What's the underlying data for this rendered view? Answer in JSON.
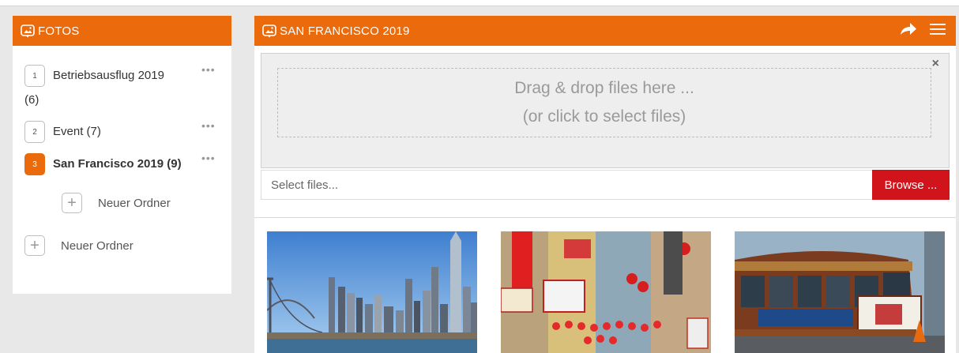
{
  "sidebar": {
    "title": "FOTOS",
    "folders": [
      {
        "index": "1",
        "name": "Betriebsausflug 2019",
        "count": "(6)",
        "active": false
      },
      {
        "index": "2",
        "name": "Event (7)",
        "active": false
      },
      {
        "index": "3",
        "name": "San Francisco 2019 (9)",
        "active": true
      }
    ],
    "more_label": "•••",
    "new_subfolder_label": "Neuer Ordner",
    "new_folder_label": "Neuer Ordner"
  },
  "main": {
    "title": "SAN FRANCISCO 2019",
    "upload": {
      "drop_line1": "Drag & drop files here ...",
      "drop_line2": "(or click to select files)",
      "close_label": "×",
      "placeholder": "Select files...",
      "browse_label": "Browse ..."
    },
    "photos": [
      {
        "subject": "skyline-bridge"
      },
      {
        "subject": "chinatown-street"
      },
      {
        "subject": "cable-car"
      }
    ]
  },
  "icons": {
    "folder_header": "photo-folder-icon",
    "share": "share-arrow-icon",
    "menu": "hamburger-menu-icon"
  },
  "colors": {
    "accent": "#ea6a0c",
    "browse": "#d1131b",
    "background": "#e8e8e8"
  }
}
